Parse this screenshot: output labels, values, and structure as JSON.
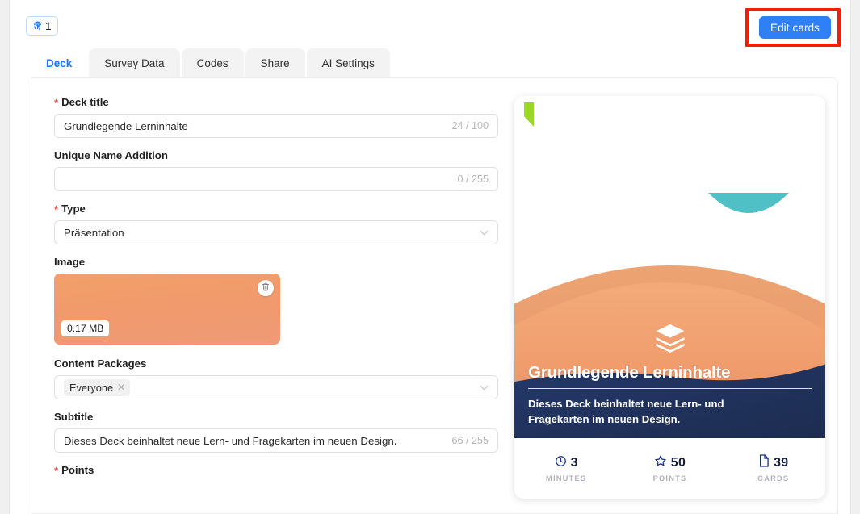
{
  "topbar": {
    "views_badge": {
      "icon": "fingerprint-icon",
      "count": "1"
    },
    "edit_cards_label": "Edit cards",
    "accent_blue": "#2f80f7",
    "highlight_color": "#f41e00"
  },
  "tabs": [
    {
      "label": "Deck",
      "active": true
    },
    {
      "label": "Survey Data",
      "active": false
    },
    {
      "label": "Codes",
      "active": false
    },
    {
      "label": "Share",
      "active": false
    },
    {
      "label": "AI Settings",
      "active": false
    }
  ],
  "form": {
    "deck_title": {
      "label": "Deck title",
      "required": true,
      "value": "Grundlegende Lerninhalte",
      "counter": "24 / 100"
    },
    "unique_name_addition": {
      "label": "Unique Name Addition",
      "required": false,
      "value": "",
      "counter": "0 / 255"
    },
    "type": {
      "label": "Type",
      "required": true,
      "value": "Präsentation"
    },
    "image": {
      "label": "Image",
      "required": false,
      "file_size": "0.17 MB",
      "delete_icon": "trash-icon"
    },
    "content_packages": {
      "label": "Content Packages",
      "required": false,
      "chips": [
        "Everyone"
      ]
    },
    "subtitle": {
      "label": "Subtitle",
      "required": false,
      "value": "Dieses Deck beinhaltet neue Lern- und Fragekarten im neuen Design.",
      "counter": "66 / 255"
    },
    "points": {
      "label": "Points",
      "required": true
    }
  },
  "preview": {
    "title": "Grundlegende Lerninhalte",
    "description": "Dieses Deck beinhaltet neue Lern- und Fragekarten im neuen Design.",
    "center_icon": "layers-stack-icon",
    "colors": {
      "orange": "#f0a06f",
      "navy": "#233a66",
      "teal": "#4ec0c6",
      "leaf_green": "#9bd62b"
    },
    "stats": [
      {
        "icon": "clock-icon",
        "value": "3",
        "label": "MINUTES"
      },
      {
        "icon": "star-icon",
        "value": "50",
        "label": "POINTS"
      },
      {
        "icon": "file-icon",
        "value": "39",
        "label": "CARDS"
      }
    ]
  }
}
